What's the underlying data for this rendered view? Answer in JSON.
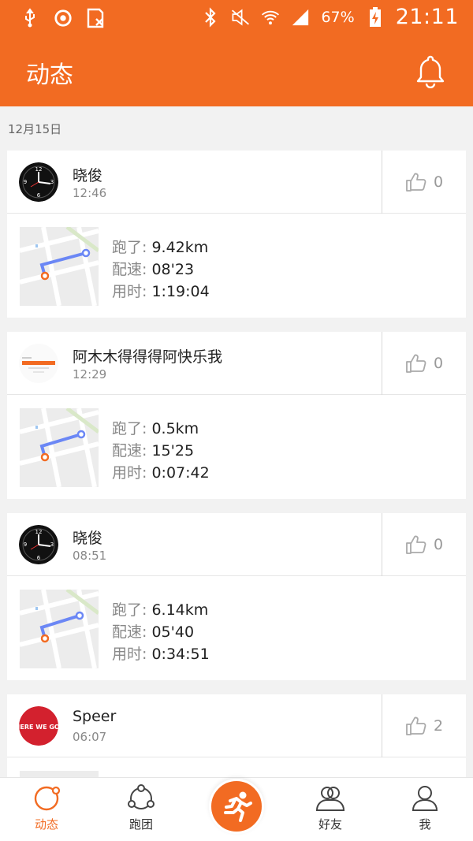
{
  "status_bar": {
    "battery_percent": "67%",
    "time": "21:11",
    "icons": [
      "usb-icon",
      "sync-icon",
      "sim-icon",
      "bluetooth-icon",
      "mute-icon",
      "wifi-icon",
      "signal-icon",
      "battery-charging-icon"
    ]
  },
  "header": {
    "title": "动态",
    "notification_icon": "bell-icon"
  },
  "date_label": "12月15日",
  "feed": [
    {
      "name": "晓俊",
      "time": "12:46",
      "likes": "0",
      "avatar": "clock-avatar",
      "distance_label": "跑了:",
      "distance": "9.42km",
      "pace_label": "配速:",
      "pace": "08'23",
      "duration_label": "用时:",
      "duration": "1:19:04"
    },
    {
      "name": "阿木木得得得阿快乐我",
      "time": "12:29",
      "likes": "0",
      "avatar": "screenshot-avatar",
      "distance_label": "跑了:",
      "distance": "0.5km",
      "pace_label": "配速:",
      "pace": "15'25",
      "duration_label": "用时:",
      "duration": "0:07:42"
    },
    {
      "name": "晓俊",
      "time": "08:51",
      "likes": "0",
      "avatar": "clock-avatar",
      "distance_label": "跑了:",
      "distance": "6.14km",
      "pace_label": "配速:",
      "pace": "05'40",
      "duration_label": "用时:",
      "duration": "0:34:51"
    },
    {
      "name": "Speer",
      "time": "06:07",
      "likes": "2",
      "avatar": "here-we-go-avatar",
      "avatar_text": "HERE WE GO!"
    }
  ],
  "tabs": [
    {
      "label": "动态",
      "icon": "feed-icon",
      "active": true
    },
    {
      "label": "跑团",
      "icon": "team-icon",
      "active": false
    },
    {
      "label": "",
      "icon": "runner-icon",
      "active": false
    },
    {
      "label": "好友",
      "icon": "friends-icon",
      "active": false
    },
    {
      "label": "我",
      "icon": "profile-icon",
      "active": false
    }
  ],
  "colors": {
    "brand": "#f26b22",
    "background": "#f2f2f2",
    "route": "#6b87f5"
  }
}
